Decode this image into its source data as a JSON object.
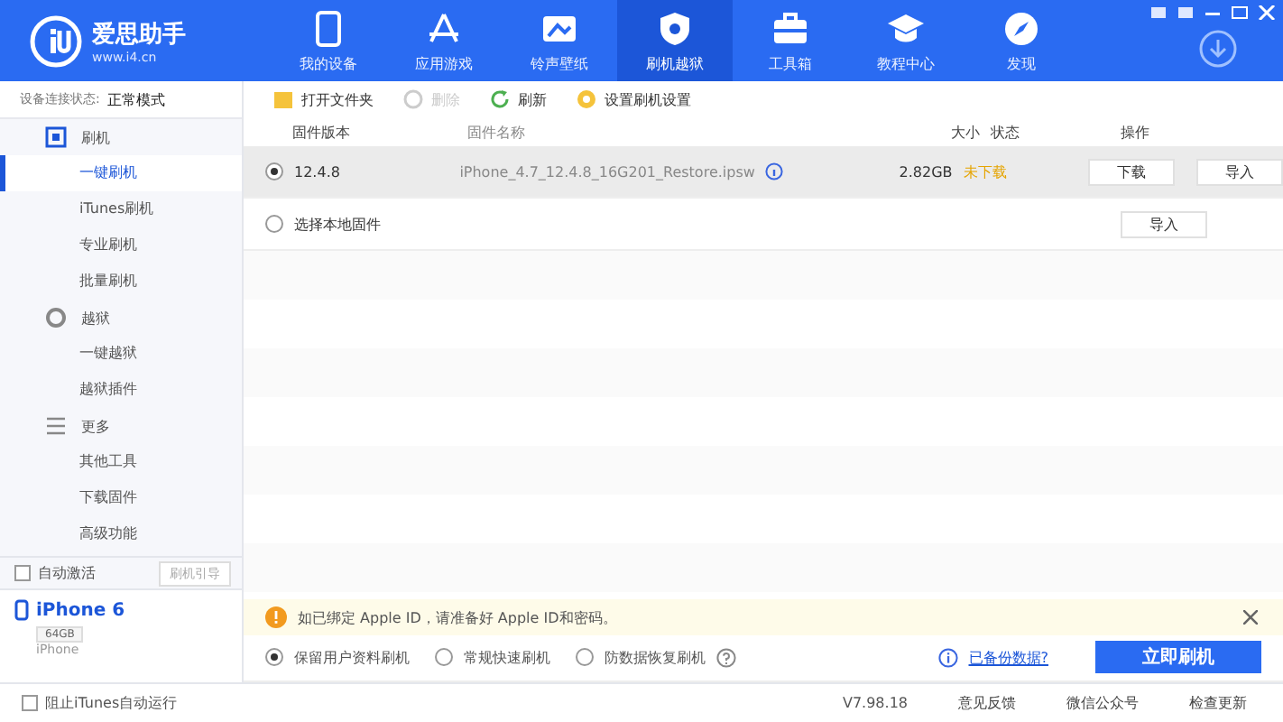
{
  "header": {
    "logo_title": "爱思助手",
    "logo_url": "www.i4.cn",
    "nav": [
      {
        "label": "我的设备",
        "selected": false
      },
      {
        "label": "应用游戏",
        "selected": false
      },
      {
        "label": "铃声壁纸",
        "selected": false
      },
      {
        "label": "刷机越狱",
        "selected": true
      },
      {
        "label": "工具箱",
        "selected": false
      },
      {
        "label": "教程中心",
        "selected": false
      },
      {
        "label": "发现",
        "selected": false
      }
    ]
  },
  "sidebar": {
    "status_label": "设备连接状态:",
    "status_value": "正常模式",
    "groups": [
      {
        "label": "刷机",
        "children": [
          {
            "label": "一键刷机",
            "selected": true
          },
          {
            "label": "iTunes刷机",
            "selected": false
          },
          {
            "label": "专业刷机",
            "selected": false
          },
          {
            "label": "批量刷机",
            "selected": false
          }
        ]
      },
      {
        "label": "越狱",
        "children": [
          {
            "label": "一键越狱",
            "selected": false
          },
          {
            "label": "越狱插件",
            "selected": false
          }
        ]
      },
      {
        "label": "更多",
        "children": [
          {
            "label": "其他工具",
            "selected": false
          },
          {
            "label": "下载固件",
            "selected": false
          },
          {
            "label": "高级功能",
            "selected": false
          }
        ]
      }
    ],
    "auto_activate": {
      "label": "自动激活",
      "checked": false
    },
    "guide_button": "刷机引导",
    "device": {
      "name": "iPhone 6",
      "capacity": "64GB",
      "model": "iPhone"
    },
    "block_itunes": {
      "label": "阻止iTunes自动运行",
      "checked": false
    }
  },
  "toolbar": [
    {
      "label": "打开文件夹",
      "disabled": false
    },
    {
      "label": "删除",
      "disabled": true
    },
    {
      "label": "刷新",
      "disabled": false
    },
    {
      "label": "设置刷机设置",
      "disabled": false
    }
  ],
  "table": {
    "columns": [
      "固件版本",
      "固件名称",
      "大小",
      "状态",
      "操作"
    ],
    "rows": [
      {
        "selected": true,
        "version": "12.4.8",
        "name": "iPhone_4.7_12.4.8_16G201_Restore.ipsw",
        "size": "2.82GB",
        "status": "未下载",
        "actions": [
          "下载",
          "导入"
        ]
      },
      {
        "selected": false,
        "version": "选择本地固件",
        "actions": [
          "导入"
        ]
      }
    ]
  },
  "notice": {
    "text": "如已绑定 Apple ID，请准备好 Apple ID和密码。"
  },
  "options": [
    {
      "label": "保留用户资料刷机",
      "selected": true,
      "help": false
    },
    {
      "label": "常规快速刷机",
      "selected": false,
      "help": false
    },
    {
      "label": "防数据恢复刷机",
      "selected": false,
      "help": true
    }
  ],
  "info_link": "已备份数据?",
  "flash_button": "立即刷机",
  "status_bar": {
    "version": "V7.98.18",
    "links": [
      "意见反馈",
      "微信公众号",
      "检查更新"
    ]
  }
}
